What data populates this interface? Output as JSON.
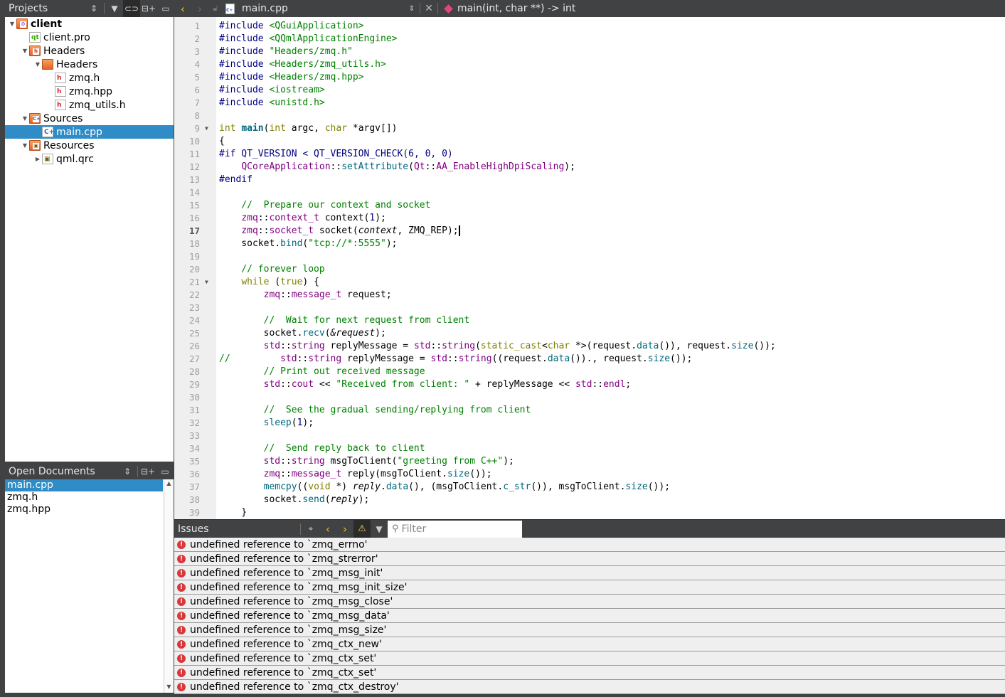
{
  "projects_panel": {
    "title": "Projects",
    "tools": [
      "sort-icon",
      "filter-icon",
      "link-icon",
      "split-icon",
      "close-pane-icon"
    ],
    "tree": [
      {
        "label": "client",
        "depth": 0,
        "expanded": true,
        "icon": "project-folder-icon",
        "bold": true
      },
      {
        "label": "client.pro",
        "depth": 1,
        "icon": "qt-file-icon"
      },
      {
        "label": "Headers",
        "depth": 1,
        "expanded": true,
        "icon": "headers-folder-icon"
      },
      {
        "label": "Headers",
        "depth": 2,
        "expanded": true,
        "icon": "folder-icon"
      },
      {
        "label": "zmq.h",
        "depth": 3,
        "icon": "header-file-icon"
      },
      {
        "label": "zmq.hpp",
        "depth": 3,
        "icon": "header-file-icon"
      },
      {
        "label": "zmq_utils.h",
        "depth": 3,
        "icon": "header-file-icon"
      },
      {
        "label": "Sources",
        "depth": 1,
        "expanded": true,
        "icon": "sources-folder-icon"
      },
      {
        "label": "main.cpp",
        "depth": 2,
        "icon": "cpp-file-icon",
        "selected": true
      },
      {
        "label": "Resources",
        "depth": 1,
        "expanded": true,
        "icon": "resources-folder-icon"
      },
      {
        "label": "qml.qrc",
        "depth": 2,
        "expanded": false,
        "icon": "qrc-file-icon"
      }
    ]
  },
  "open_documents": {
    "title": "Open Documents",
    "items": [
      {
        "label": "main.cpp",
        "selected": true
      },
      {
        "label": "zmq.h"
      },
      {
        "label": "zmq.hpp"
      }
    ]
  },
  "editor_toolbar": {
    "file_name": "main.cpp",
    "symbol": "main(int, char **) -> int"
  },
  "editor": {
    "current_line": 17,
    "lines": [
      {
        "n": 1,
        "text": "#include <QGuiApplication>"
      },
      {
        "n": 2,
        "text": "#include <QQmlApplicationEngine>"
      },
      {
        "n": 3,
        "text": "#include \"Headers/zmq.h\""
      },
      {
        "n": 4,
        "text": "#include <Headers/zmq_utils.h>"
      },
      {
        "n": 5,
        "text": "#include <Headers/zmq.hpp>"
      },
      {
        "n": 6,
        "text": "#include <iostream>"
      },
      {
        "n": 7,
        "text": "#include <unistd.h>"
      },
      {
        "n": 8,
        "text": ""
      },
      {
        "n": 9,
        "text": "int main(int argc, char *argv[])",
        "fold": true
      },
      {
        "n": 10,
        "text": "{"
      },
      {
        "n": 11,
        "text": "#if QT_VERSION < QT_VERSION_CHECK(6, 0, 0)"
      },
      {
        "n": 12,
        "text": "    QCoreApplication::setAttribute(Qt::AA_EnableHighDpiScaling);"
      },
      {
        "n": 13,
        "text": "#endif"
      },
      {
        "n": 14,
        "text": ""
      },
      {
        "n": 15,
        "text": "    //  Prepare our context and socket"
      },
      {
        "n": 16,
        "text": "    zmq::context_t context(1);"
      },
      {
        "n": 17,
        "text": "    zmq::socket_t socket(context, ZMQ_REP);"
      },
      {
        "n": 18,
        "text": "    socket.bind(\"tcp://*:5555\");"
      },
      {
        "n": 19,
        "text": ""
      },
      {
        "n": 20,
        "text": "    // forever loop"
      },
      {
        "n": 21,
        "text": "    while (true) {",
        "fold": true
      },
      {
        "n": 22,
        "text": "        zmq::message_t request;"
      },
      {
        "n": 23,
        "text": ""
      },
      {
        "n": 24,
        "text": "        //  Wait for next request from client"
      },
      {
        "n": 25,
        "text": "        socket.recv(&request);"
      },
      {
        "n": 26,
        "text": "        std::string replyMessage = std::string(static_cast<char *>(request.data()), request.size());"
      },
      {
        "n": 27,
        "text": "//         std::string replyMessage = std::string((request.data())., request.size());"
      },
      {
        "n": 28,
        "text": "        // Print out received message"
      },
      {
        "n": 29,
        "text": "        std::cout << \"Received from client: \" + replyMessage << std::endl;"
      },
      {
        "n": 30,
        "text": ""
      },
      {
        "n": 31,
        "text": "        //  See the gradual sending/replying from client"
      },
      {
        "n": 32,
        "text": "        sleep(1);"
      },
      {
        "n": 33,
        "text": ""
      },
      {
        "n": 34,
        "text": "        //  Send reply back to client"
      },
      {
        "n": 35,
        "text": "        std::string msgToClient(\"greeting from C++\");"
      },
      {
        "n": 36,
        "text": "        zmq::message_t reply(msgToClient.size());"
      },
      {
        "n": 37,
        "text": "        memcpy((void *) reply.data(), (msgToClient.c_str()), msgToClient.size());"
      },
      {
        "n": 38,
        "text": "        socket.send(reply);"
      },
      {
        "n": 39,
        "text": "    }"
      }
    ]
  },
  "issues": {
    "title": "Issues",
    "filter_placeholder": "Filter",
    "items": [
      "undefined reference to `zmq_errno'",
      "undefined reference to `zmq_strerror'",
      "undefined reference to `zmq_msg_init'",
      "undefined reference to `zmq_msg_init_size'",
      "undefined reference to `zmq_msg_close'",
      "undefined reference to `zmq_msg_data'",
      "undefined reference to `zmq_msg_size'",
      "undefined reference to `zmq_ctx_new'",
      "undefined reference to `zmq_ctx_set'",
      "undefined reference to `zmq_ctx_set'",
      "undefined reference to `zmq_ctx_destroy'"
    ]
  },
  "colors": {
    "chrome": "#404244",
    "selection": "#308cc6",
    "error": "#d9383a",
    "accent_yellow": "#e8c02c"
  }
}
